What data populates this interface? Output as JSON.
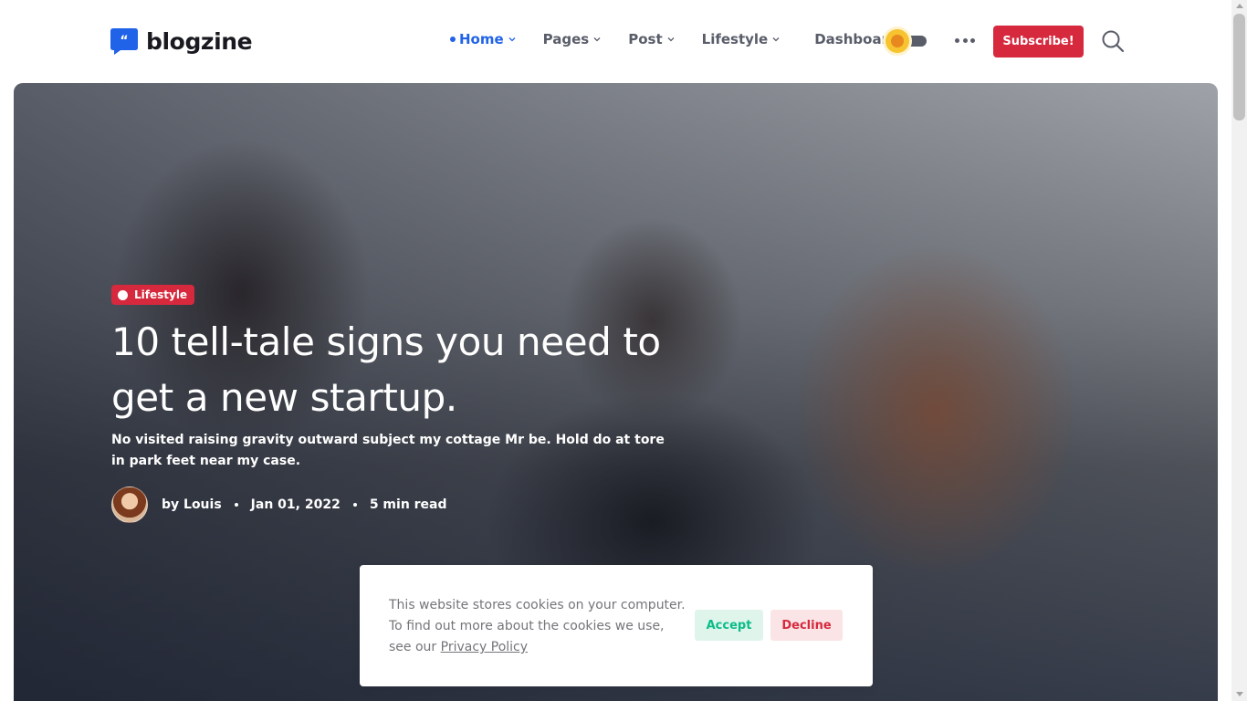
{
  "header": {
    "logo_text": "blogzine",
    "nav": [
      {
        "label": "Home",
        "active": true,
        "has_dropdown": true
      },
      {
        "label": "Pages",
        "active": false,
        "has_dropdown": true
      },
      {
        "label": "Post",
        "active": false,
        "has_dropdown": true
      },
      {
        "label": "Lifestyle",
        "active": false,
        "has_dropdown": true
      },
      {
        "label": "Dashboard",
        "active": false,
        "has_dropdown": false
      }
    ],
    "subscribe_label": "Subscribe!",
    "icons": {
      "theme_toggle": "sun-icon",
      "more": "more-dots-icon",
      "search": "search-icon"
    }
  },
  "hero": {
    "category": "Lifestyle",
    "title": "10 tell-tale signs you need to get a new startup.",
    "description": "No visited raising gravity outward subject my cottage Mr be. Hold do at tore in park feet near my case.",
    "author": "by Louis",
    "date": "Jan 01, 2022",
    "read_time": "5 min read"
  },
  "cookie": {
    "text_before_link": "This website stores cookies on your computer. To find out more about the cookies we use, see our ",
    "link_text": "Privacy Policy",
    "accept_label": "Accept",
    "decline_label": "Decline"
  },
  "colors": {
    "primary": "#2163e8",
    "danger": "#d6293e",
    "success": "#0cbc87",
    "nav_text": "#595d69"
  }
}
